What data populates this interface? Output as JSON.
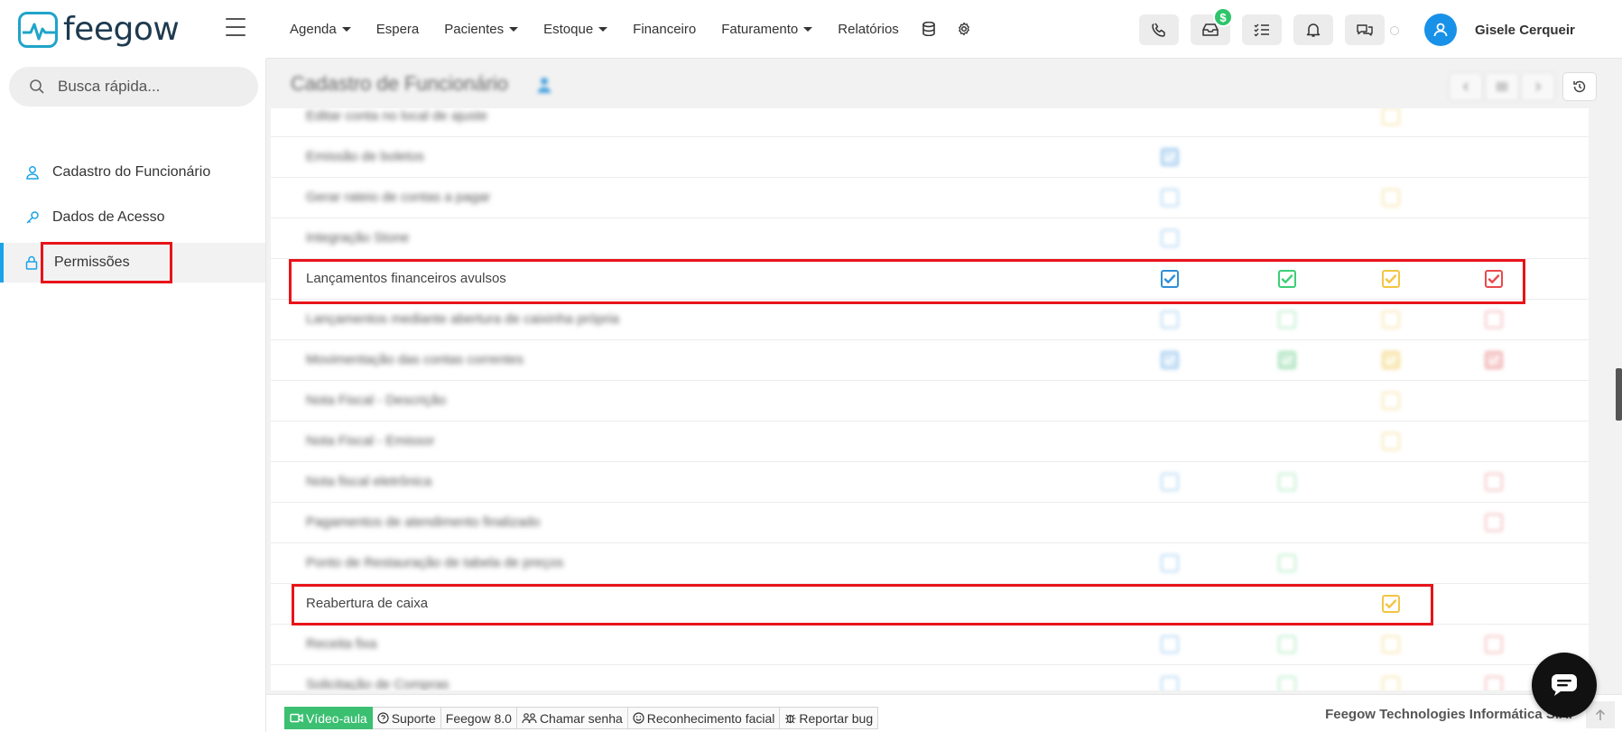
{
  "app": {
    "logo_text": "feegow",
    "user_name": "Gisele Cerqueir",
    "notification_badge": "$"
  },
  "topnav": {
    "items": [
      {
        "label": "Agenda",
        "dropdown": true
      },
      {
        "label": "Espera",
        "dropdown": false
      },
      {
        "label": "Pacientes",
        "dropdown": true
      },
      {
        "label": "Estoque",
        "dropdown": true
      },
      {
        "label": "Financeiro",
        "dropdown": false
      },
      {
        "label": "Faturamento",
        "dropdown": true
      },
      {
        "label": "Relatórios",
        "dropdown": false
      }
    ]
  },
  "sidebar": {
    "search_placeholder": "Busca rápida...",
    "items": [
      {
        "label": "Cadastro do Funcionário",
        "icon": "user-icon"
      },
      {
        "label": "Dados de Acesso",
        "icon": "key-icon"
      },
      {
        "label": "Permissões",
        "icon": "lock-icon",
        "active": true
      }
    ]
  },
  "page": {
    "title": "Cadastro de Funcionário"
  },
  "permissions": {
    "rows": [
      {
        "label": "Editar conta no local de ajuste",
        "blurred": true,
        "boxes": [
          "",
          "",
          "faint",
          ""
        ]
      },
      {
        "label": "Emissão de boletos",
        "blurred": true,
        "boxes": [
          "fill",
          "",
          "",
          ""
        ]
      },
      {
        "label": "Gerar rateio de contas a pagar",
        "blurred": true,
        "boxes": [
          "faint",
          "",
          "faint",
          ""
        ]
      },
      {
        "label": "Integração Stone",
        "blurred": true,
        "boxes": [
          "faint",
          "",
          "",
          ""
        ]
      },
      {
        "label": "Lançamentos financeiros avulsos",
        "blurred": false,
        "boxes": [
          "checked",
          "checked",
          "checked",
          "checked"
        ]
      },
      {
        "label": "Lançamentos mediante abertura de caixinha própria",
        "blurred": true,
        "boxes": [
          "faint",
          "faint",
          "faint",
          "faint"
        ]
      },
      {
        "label": "Movimentação das contas correntes",
        "blurred": true,
        "boxes": [
          "fill",
          "fill",
          "fill",
          "fill"
        ]
      },
      {
        "label": "Nota Fiscal - Descrição",
        "blurred": true,
        "boxes": [
          "",
          "",
          "faint",
          ""
        ]
      },
      {
        "label": "Nota Fiscal - Emissor",
        "blurred": true,
        "boxes": [
          "",
          "",
          "faint",
          ""
        ]
      },
      {
        "label": "Nota fiscal eletrônica",
        "blurred": true,
        "boxes": [
          "faint",
          "faint",
          "",
          "faint"
        ]
      },
      {
        "label": "Pagamentos de atendimento finalizado",
        "blurred": true,
        "boxes": [
          "",
          "",
          "",
          "faint"
        ]
      },
      {
        "label": "Ponto de Restauração de tabela de preços",
        "blurred": true,
        "boxes": [
          "faint",
          "faint",
          "",
          ""
        ]
      },
      {
        "label": "Reabertura de caixa",
        "blurred": false,
        "boxes": [
          "",
          "",
          "checked",
          ""
        ]
      },
      {
        "label": "Receita fixa",
        "blurred": true,
        "boxes": [
          "faint",
          "faint",
          "faint",
          "faint"
        ]
      },
      {
        "label": "Solicitação de Compras",
        "blurred": true,
        "boxes": [
          "faint",
          "faint",
          "faint",
          "faint"
        ]
      }
    ]
  },
  "footer": {
    "links": [
      "Vídeo-aula",
      "Suporte",
      "Feegow 8.0",
      "Chamar senha",
      "Reconhecimento facial",
      "Reportar bug"
    ],
    "company": "Feegow Technologies Informática S.A."
  },
  "colors": {
    "accent": "#1aa3e8",
    "highlight": "#e8141a",
    "col_blue": "#2f8fd8",
    "col_green": "#3ccf75",
    "col_yellow": "#f4c542",
    "col_red": "#e84a4a"
  }
}
